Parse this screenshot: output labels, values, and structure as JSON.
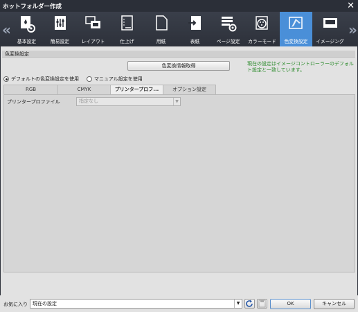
{
  "window": {
    "title": "ホットフォルダー作成"
  },
  "toolbar": {
    "items": [
      {
        "label": "基本設定",
        "icon": "folder-drop-gear-icon"
      },
      {
        "label": "簡易設定",
        "icon": "sliders-icon"
      },
      {
        "label": "レイアウト",
        "icon": "layout-icon"
      },
      {
        "label": "仕上げ",
        "icon": "finishing-icon"
      },
      {
        "label": "用紙",
        "icon": "paper-icon"
      },
      {
        "label": "表紙",
        "icon": "cover-icon"
      },
      {
        "label": "ページ設定",
        "icon": "page-setting-gear-icon"
      },
      {
        "label": "カラーモード",
        "icon": "color-palette-icon"
      },
      {
        "label": "色変換設定",
        "icon": "color-conversion-icon"
      },
      {
        "label": "イメージング",
        "icon": "imaging-icon"
      }
    ],
    "active_index": 8
  },
  "section": {
    "title": "色変換設定"
  },
  "get_button_label": "色変換情報取得",
  "status_message": "現在の設定はイメージコントローラーのデフォルト設定と一致しています。",
  "radios": {
    "default_label": "デフォルトの色変換設定を使用",
    "manual_label": "マニュアル設定を使用",
    "selected": "default"
  },
  "tabs": [
    {
      "label": "RGB"
    },
    {
      "label": "CMYK"
    },
    {
      "label": "プリンタープロフ..."
    },
    {
      "label": "オプション設定"
    }
  ],
  "active_tab": 2,
  "printer_profile": {
    "label": "プリンタープロファイル",
    "value": "指定なし"
  },
  "footer": {
    "favorites_label": "お気に入り",
    "favorites_value": "現在の設定",
    "ok_label": "OK",
    "cancel_label": "キャンセル"
  },
  "colors": {
    "accent": "#4a8fd8",
    "status_green": "#2a8a2a",
    "titlebar": "#2b2f38"
  }
}
